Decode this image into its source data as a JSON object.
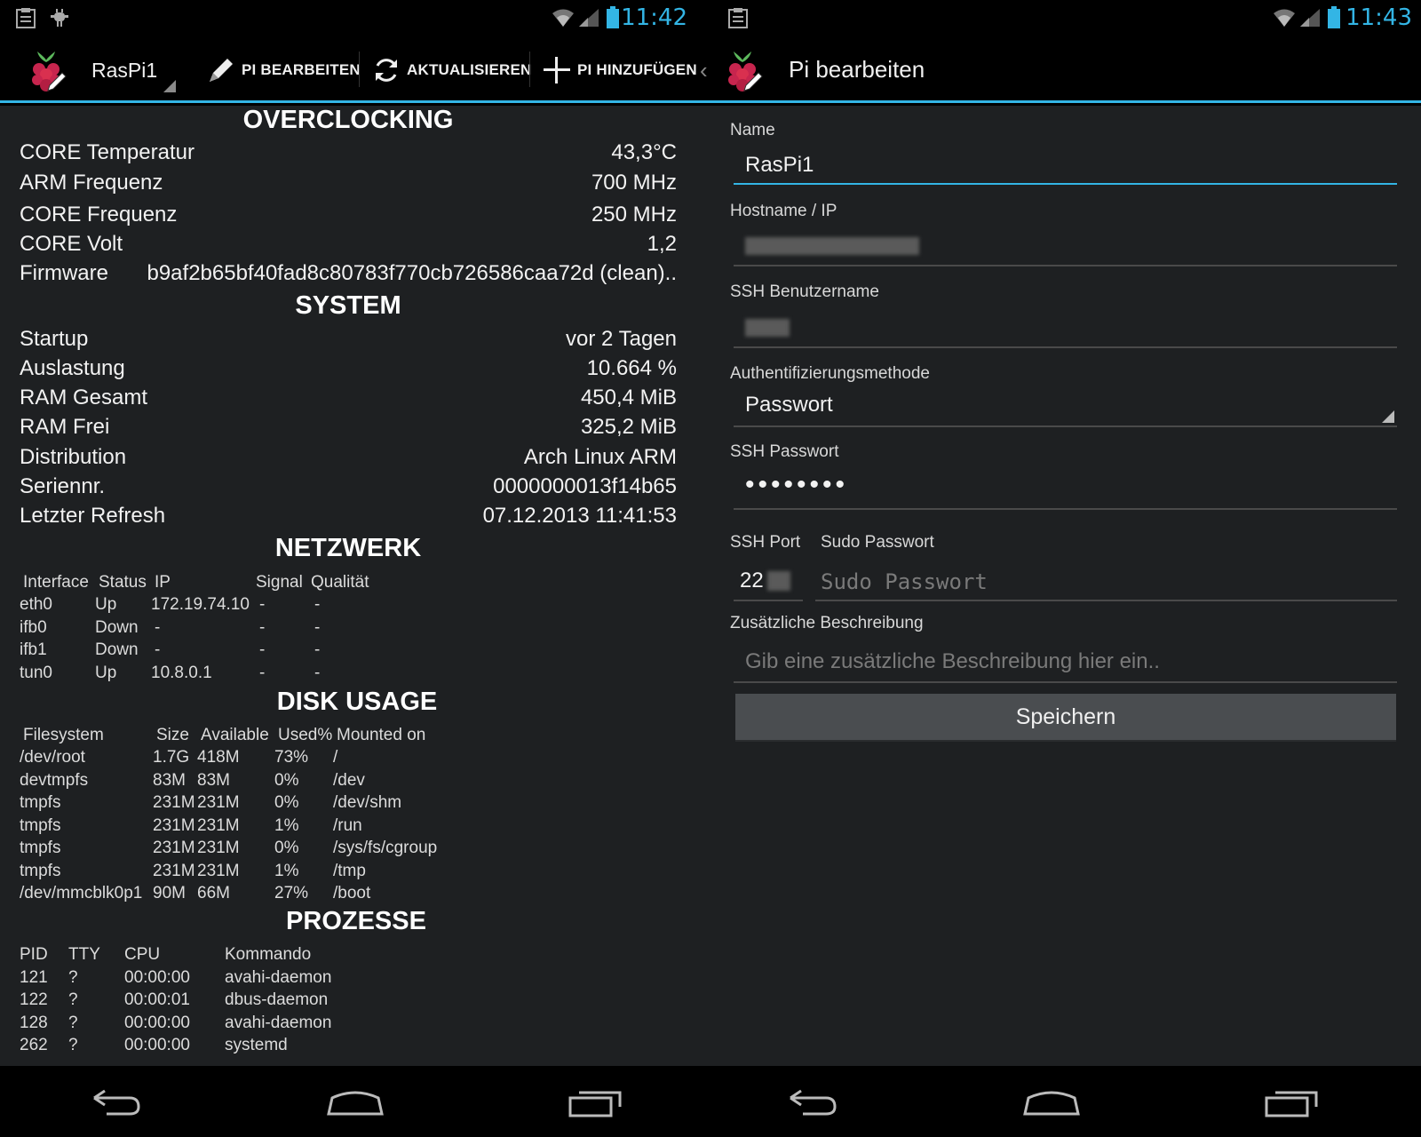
{
  "left": {
    "statusbar": {
      "time": "11:42"
    },
    "actionbar": {
      "title": "RasPi1",
      "actions": [
        "PI BEARBEITEN",
        "AKTUALISIEREN",
        "PI HINZUFÜGEN"
      ]
    },
    "overclocking": {
      "title": "OVERCLOCKING",
      "rows": [
        {
          "label": "CORE Temperatur",
          "value": "43,3°C"
        },
        {
          "label": "ARM Frequenz",
          "value": "700 MHz"
        },
        {
          "label": "CORE Frequenz",
          "value": "250 MHz"
        },
        {
          "label": "CORE Volt",
          "value": "1,2"
        },
        {
          "label": "Firmware",
          "value": "b9af2b65bf40fad8c80783f770cb726586caa72d (clean).."
        }
      ]
    },
    "system": {
      "title": "SYSTEM",
      "rows": [
        {
          "label": "Startup",
          "value": "vor 2 Tagen"
        },
        {
          "label": "Auslastung",
          "value": "10.664 %"
        },
        {
          "label": "RAM Gesamt",
          "value": "450,4 MiB"
        },
        {
          "label": "RAM Frei",
          "value": "325,2 MiB"
        },
        {
          "label": "Distribution",
          "value": "Arch Linux ARM"
        },
        {
          "label": "Seriennr.",
          "value": "0000000013f14b65"
        },
        {
          "label": "Letzter Refresh",
          "value": "07.12.2013 11:41:53"
        }
      ]
    },
    "network": {
      "title": "NETZWERK",
      "headers": [
        "Interface",
        "Status",
        "IP",
        "Signal",
        "Qualität"
      ],
      "rows": [
        [
          "eth0",
          "Up",
          "172.19.74.10",
          "-",
          "-"
        ],
        [
          "ifb0",
          "Down",
          "-",
          "-",
          "-"
        ],
        [
          "ifb1",
          "Down",
          "-",
          "-",
          "-"
        ],
        [
          "tun0",
          "Up",
          "10.8.0.1",
          "-",
          "-"
        ]
      ]
    },
    "disk": {
      "title": "DISK USAGE",
      "headers": [
        "Filesystem",
        "Size",
        "Available",
        "Used%",
        "Mounted on"
      ],
      "rows": [
        [
          "/dev/root",
          "1.7G",
          "418M",
          "73%",
          "/"
        ],
        [
          "devtmpfs",
          "83M",
          "83M",
          "0%",
          "/dev"
        ],
        [
          "tmpfs",
          "231M",
          "231M",
          "0%",
          "/dev/shm"
        ],
        [
          "tmpfs",
          "231M",
          "231M",
          "1%",
          "/run"
        ],
        [
          "tmpfs",
          "231M",
          "231M",
          "0%",
          "/sys/fs/cgroup"
        ],
        [
          "tmpfs",
          "231M",
          "231M",
          "1%",
          "/tmp"
        ],
        [
          "/dev/mmcblk0p1",
          "90M",
          "66M",
          "27%",
          "/boot"
        ]
      ]
    },
    "processes": {
      "title": "PROZESSE",
      "headers": [
        "PID",
        "TTY",
        "CPU",
        "Kommando"
      ],
      "rows": [
        [
          "121",
          "?",
          "00:00:00",
          "avahi-daemon"
        ],
        [
          "122",
          "?",
          "00:00:01",
          "dbus-daemon"
        ],
        [
          "128",
          "?",
          "00:00:00",
          "avahi-daemon"
        ],
        [
          "262",
          "?",
          "00:00:00",
          "systemd"
        ]
      ]
    }
  },
  "right": {
    "statusbar": {
      "time": "11:43"
    },
    "actionbar": {
      "title": "Pi bearbeiten"
    },
    "form": {
      "name_label": "Name",
      "name_value": "RasPi1",
      "host_label": "Hostname / IP",
      "user_label": "SSH Benutzername",
      "auth_label": "Authentifizierungsmethode",
      "auth_value": "Passwort",
      "password_label": "SSH Passwort",
      "password_value": "••••••••",
      "port_label": "SSH Port",
      "port_value": "22",
      "sudo_label": "Sudo Passwort",
      "sudo_placeholder": "Sudo Passwort",
      "desc_label": "Zusätzliche Beschreibung",
      "desc_placeholder": "Gib eine zusätzliche Beschreibung hier ein..",
      "save_label": "Speichern"
    }
  },
  "colors": {
    "accent": "#33b5e5",
    "background": "#1e2022",
    "bar": "#000000"
  }
}
